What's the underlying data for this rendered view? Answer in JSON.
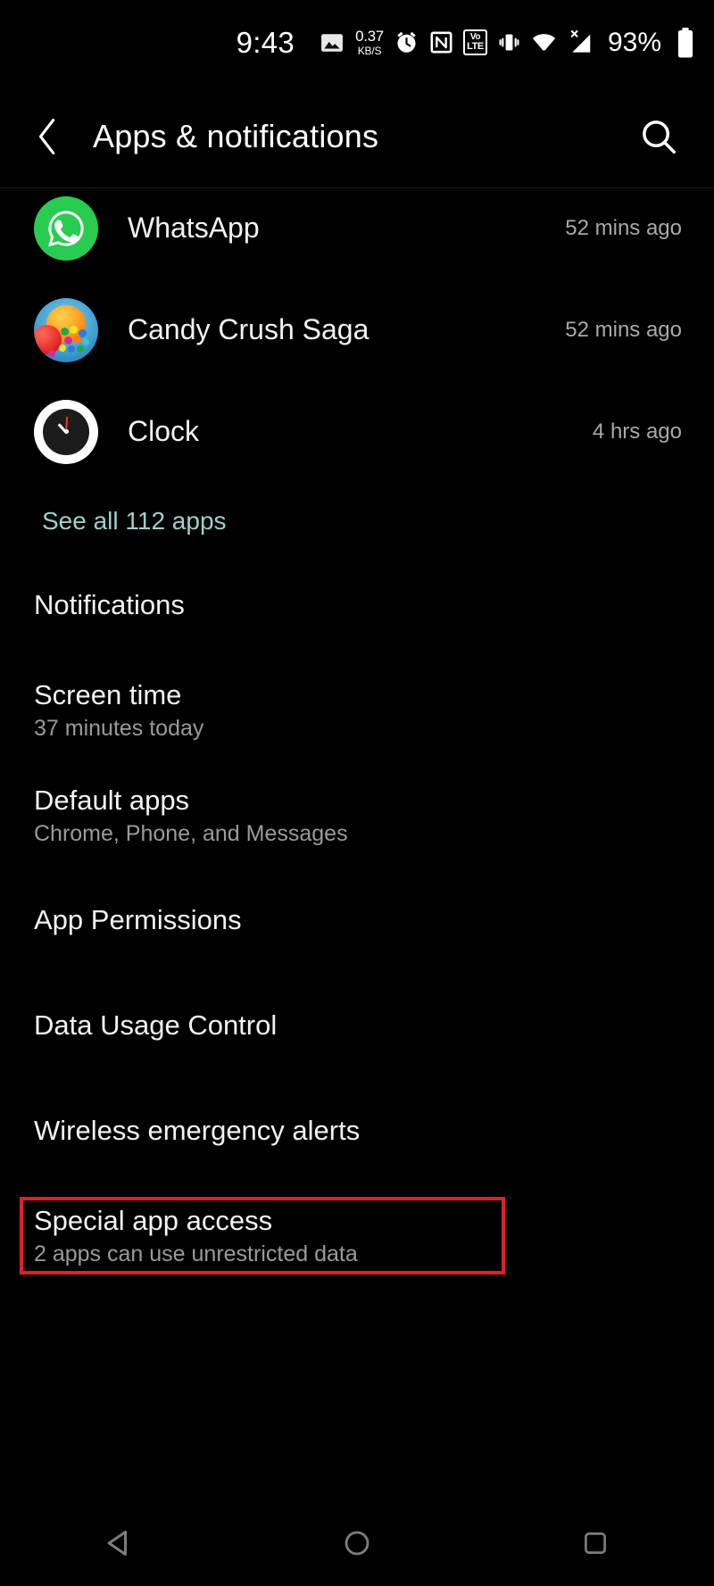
{
  "status_bar": {
    "time": "9:43",
    "icons": [
      {
        "name": "gallery-icon",
        "label": "gallery"
      },
      {
        "name": "network-speed-indicator",
        "value": "0.37",
        "unit": "KB/S"
      },
      {
        "name": "alarm-icon",
        "label": "alarm"
      },
      {
        "name": "nfc-icon",
        "label": "NFC"
      },
      {
        "name": "volte-icon",
        "line1": "VoLTE-top",
        "line2": "LTE"
      },
      {
        "name": "vibrate-icon",
        "label": "vibrate"
      },
      {
        "name": "wifi-icon",
        "label": "wifi"
      },
      {
        "name": "cellular-signal-icon",
        "label": "no-sim"
      }
    ],
    "volte_top": "VoLTE",
    "volte_line1": "Vo",
    "volte_line2": "LTE",
    "battery_percent": "93%"
  },
  "app_bar": {
    "title": "Apps & notifications",
    "back_icon": "chevron-left-icon",
    "search_icon": "search-icon"
  },
  "recent_apps": {
    "items": [
      {
        "name": "WhatsApp",
        "time": "52 mins ago",
        "icon": "whatsapp-icon"
      },
      {
        "name": "Candy Crush Saga",
        "time": "52 mins ago",
        "icon": "candy-crush-saga-icon"
      },
      {
        "name": "Clock",
        "time": "4 hrs ago",
        "icon": "clock-icon"
      }
    ],
    "see_all_label": "See all 112 apps"
  },
  "settings": {
    "items": [
      {
        "title": "Notifications",
        "subtitle": ""
      },
      {
        "title": "Screen time",
        "subtitle": "37 minutes today"
      },
      {
        "title": "Default apps",
        "subtitle": "Chrome, Phone, and Messages"
      },
      {
        "title": "App Permissions",
        "subtitle": ""
      },
      {
        "title": "Data Usage Control",
        "subtitle": ""
      },
      {
        "title": "Wireless emergency alerts",
        "subtitle": ""
      },
      {
        "title": "Special app access",
        "subtitle": "2 apps can use unrestricted data"
      }
    ]
  },
  "highlight": {
    "target": "Special app access",
    "color": "#e01f2d"
  },
  "nav_bar": {
    "back": "back-triangle-icon",
    "home": "home-circle-icon",
    "recents": "recents-square-icon"
  },
  "colors": {
    "background": "#000000",
    "primary_text": "#f2f2f2",
    "secondary_text": "#9a9a9a",
    "link": "#9fd0c9",
    "highlight": "#e01f2d"
  }
}
